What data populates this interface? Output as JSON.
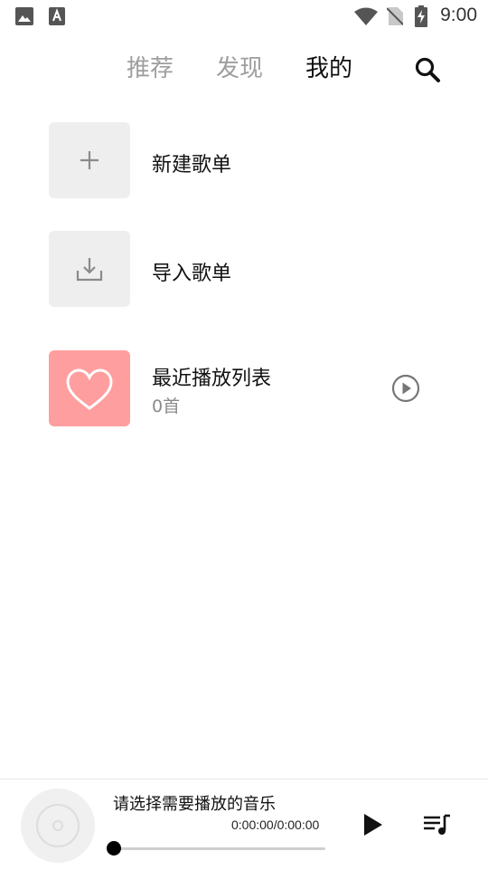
{
  "status_bar": {
    "time": "9:00",
    "left_icons": [
      "image-icon",
      "text-a-icon"
    ],
    "right_icons": [
      "wifi-icon",
      "no-sim-icon",
      "battery-charging-icon"
    ]
  },
  "tabs": [
    {
      "label": "推荐",
      "active": false
    },
    {
      "label": "发现",
      "active": false
    },
    {
      "label": "我的",
      "active": true
    }
  ],
  "search_icon": "search-icon",
  "playlists": {
    "new": {
      "label": "新建歌单",
      "icon": "plus-icon"
    },
    "import": {
      "label": "导入歌单",
      "icon": "download-icon"
    },
    "recent": {
      "title": "最近播放列表",
      "count": "0首",
      "icon": "heart-icon",
      "action_icon": "play-circle-icon"
    }
  },
  "player": {
    "title": "请选择需要播放的音乐",
    "time": "0:00:00/0:00:00",
    "progress": 0,
    "disc_icon": "disc-icon",
    "play_icon": "play-icon",
    "queue_icon": "queue-music-icon"
  },
  "colors": {
    "accent_pink": "#ff9e9e",
    "tile_gray": "#eeeeee",
    "active_tab": "#111111",
    "inactive_tab": "#9e9e9e"
  }
}
